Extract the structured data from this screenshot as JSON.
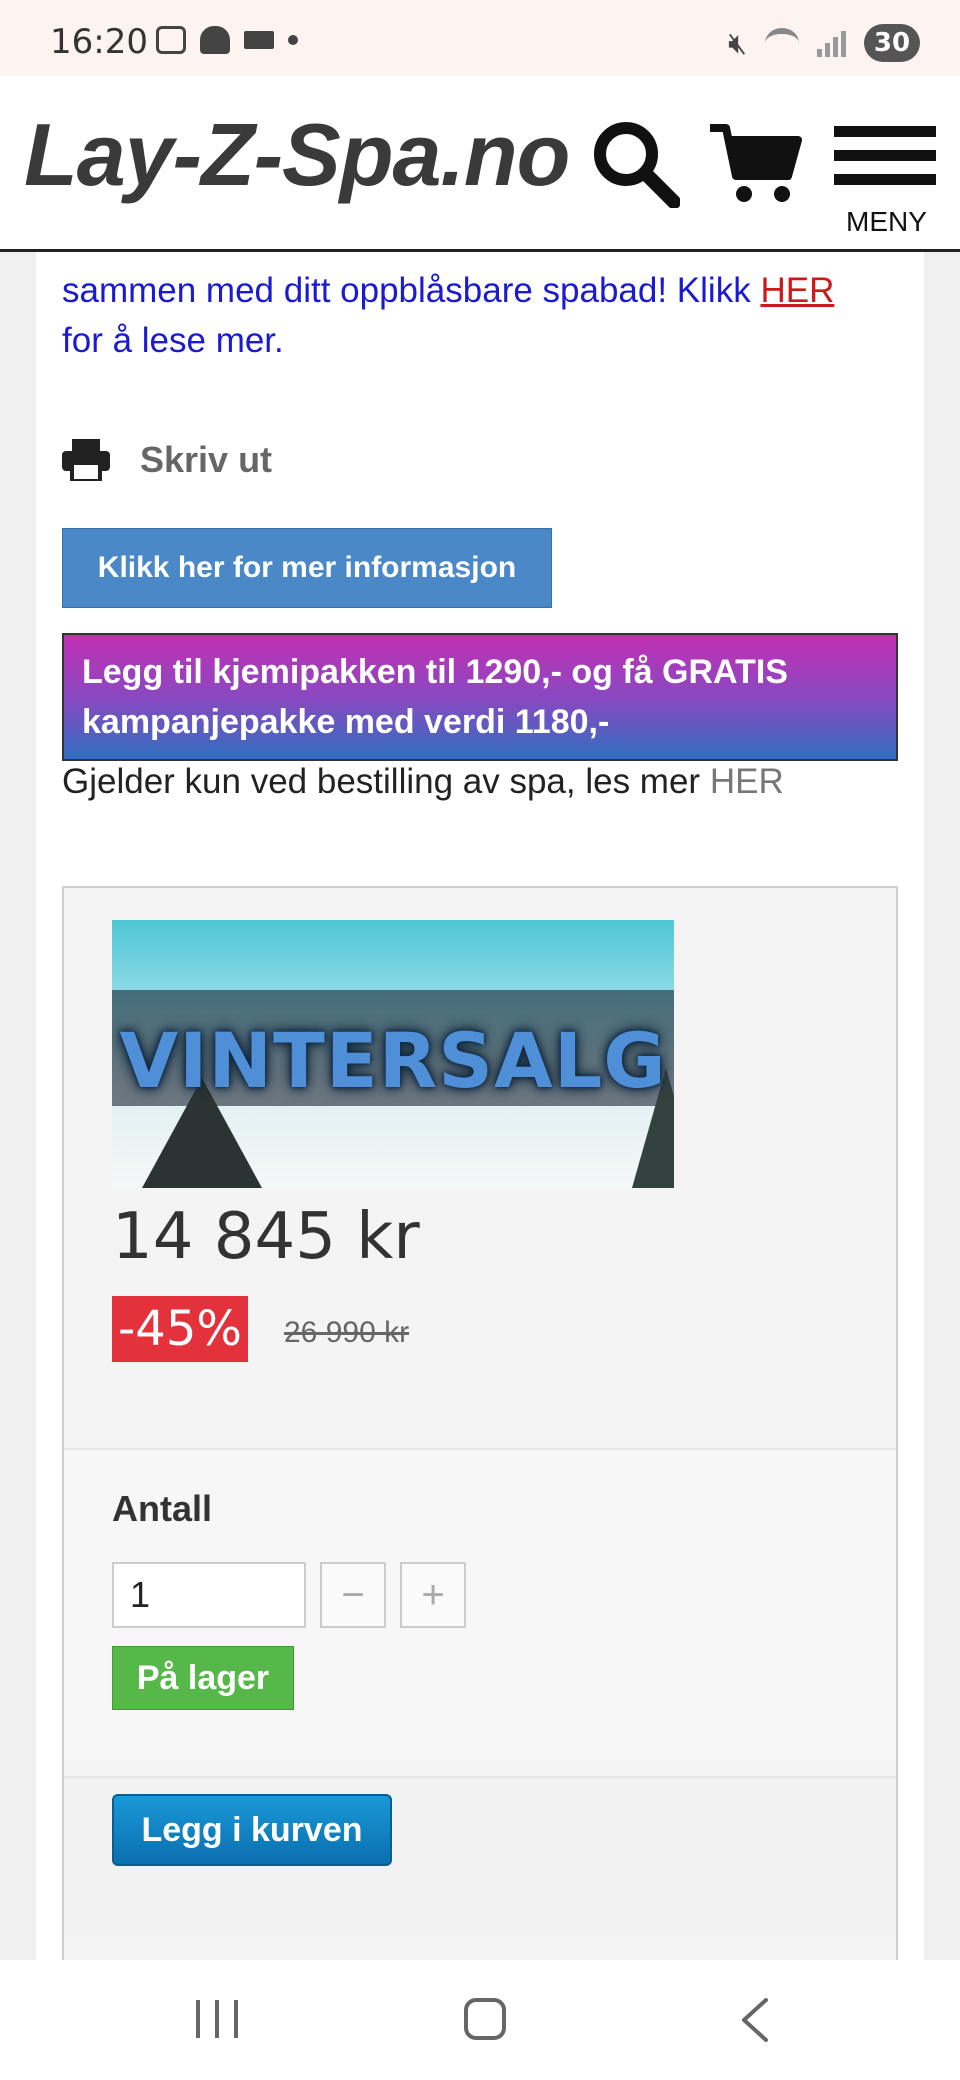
{
  "status_bar": {
    "time": "16:20",
    "battery": "30"
  },
  "header": {
    "logo": "Lay-Z-Spa.no",
    "menu_label": "MENY"
  },
  "promo": {
    "line_before": "sammen med ditt oppblåsbare spabad! Klikk",
    "link": "HER",
    "line_after": "for å lese mer."
  },
  "print_label": "Skriv ut",
  "info_button": "Klikk her for mer informasjon",
  "banner": {
    "line1": "Legg til kjemipakken til 1290,- og få GRATIS",
    "line2": "kampanjepakke med verdi 1180,-"
  },
  "kit_note": {
    "text": "Gjelder kun ved bestilling av spa, les mer",
    "link": "HER"
  },
  "product": {
    "image_text": "VINTERSALG",
    "price": "14 845 kr",
    "discount": "-45%",
    "old_price": "26 990 kr",
    "qty_label": "Antall",
    "qty_value": "1",
    "minus": "−",
    "plus": "+",
    "stock": "På lager",
    "add_to_cart": "Legg i kurven"
  },
  "colors": {
    "promo_text": "#1a1ad0",
    "link_red": "#cc1a1a",
    "info_button": "#4a88c8",
    "discount_badge": "#e3323c",
    "stock_badge": "#55b848",
    "cart_button": "#0a6fae"
  }
}
